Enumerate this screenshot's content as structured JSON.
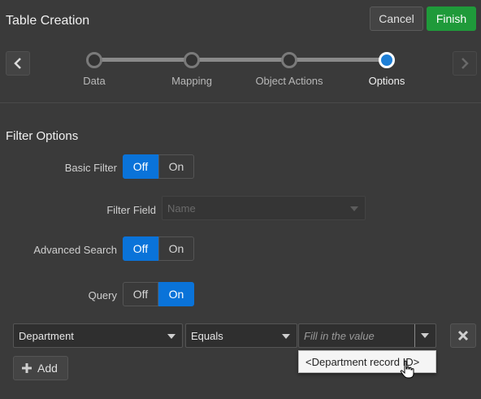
{
  "header": {
    "title": "Table Creation",
    "cancel_label": "Cancel",
    "finish_label": "Finish",
    "accent_color": "#1f9a3a"
  },
  "wizard": {
    "steps": [
      {
        "label": "Data",
        "state": "completed"
      },
      {
        "label": "Mapping",
        "state": "completed"
      },
      {
        "label": "Object Actions",
        "state": "completed"
      },
      {
        "label": "Options",
        "state": "current"
      }
    ],
    "current_step_color": "#1e7fd6"
  },
  "filter_options": {
    "section_title": "Filter Options",
    "basic_filter": {
      "label": "Basic Filter",
      "options": [
        "Off",
        "On"
      ],
      "selected": "Off"
    },
    "filter_field": {
      "label": "Filter Field",
      "value": "Name",
      "disabled": true
    },
    "advanced_search": {
      "label": "Advanced Search",
      "options": [
        "Off",
        "On"
      ],
      "selected": "Off"
    },
    "query": {
      "label": "Query",
      "options": [
        "Off",
        "On"
      ],
      "selected": "On"
    },
    "toggle_selected_color": "#0a73d9"
  },
  "query_row": {
    "field": "Department",
    "operator": "Equals",
    "value_placeholder": "Fill in the value",
    "suggestion": "<Department record ID>",
    "add_label": "Add"
  },
  "icons": {
    "prev": "chevron-left-icon",
    "next": "chevron-right-icon",
    "delete": "close-icon",
    "add": "plus-icon",
    "cursor": "hand-pointer-icon"
  }
}
